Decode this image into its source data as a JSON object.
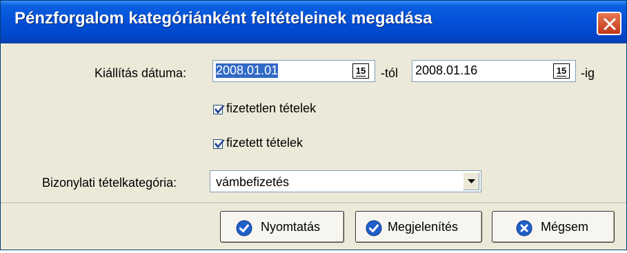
{
  "window": {
    "title": "Pénzforgalom kategóriánként feltételeinek megadása"
  },
  "form": {
    "issue_date_label": "Kiállítás dátuma:",
    "date_from": "2008.01.01",
    "from_suffix": "-tól",
    "date_to": "2008.01.16",
    "to_suffix": "-ig",
    "calendar_icon_text": "15",
    "unpaid_label": "fizetetlen tételek",
    "unpaid_checked": true,
    "paid_label": "fizetett tételek",
    "paid_checked": true,
    "category_label": "Bizonylati tételkategória:",
    "category_value": "vámbefizetés"
  },
  "buttons": {
    "print_label": "Nyomtatás",
    "display_label": "Megjelenítés",
    "cancel_label": "Mégsem"
  },
  "colors": {
    "titlebar": "#0450d6",
    "selection": "#316ac5",
    "dialog_bg": "#ece9d8",
    "icon_blue": "#1f5fc8",
    "check": "#21409a"
  }
}
